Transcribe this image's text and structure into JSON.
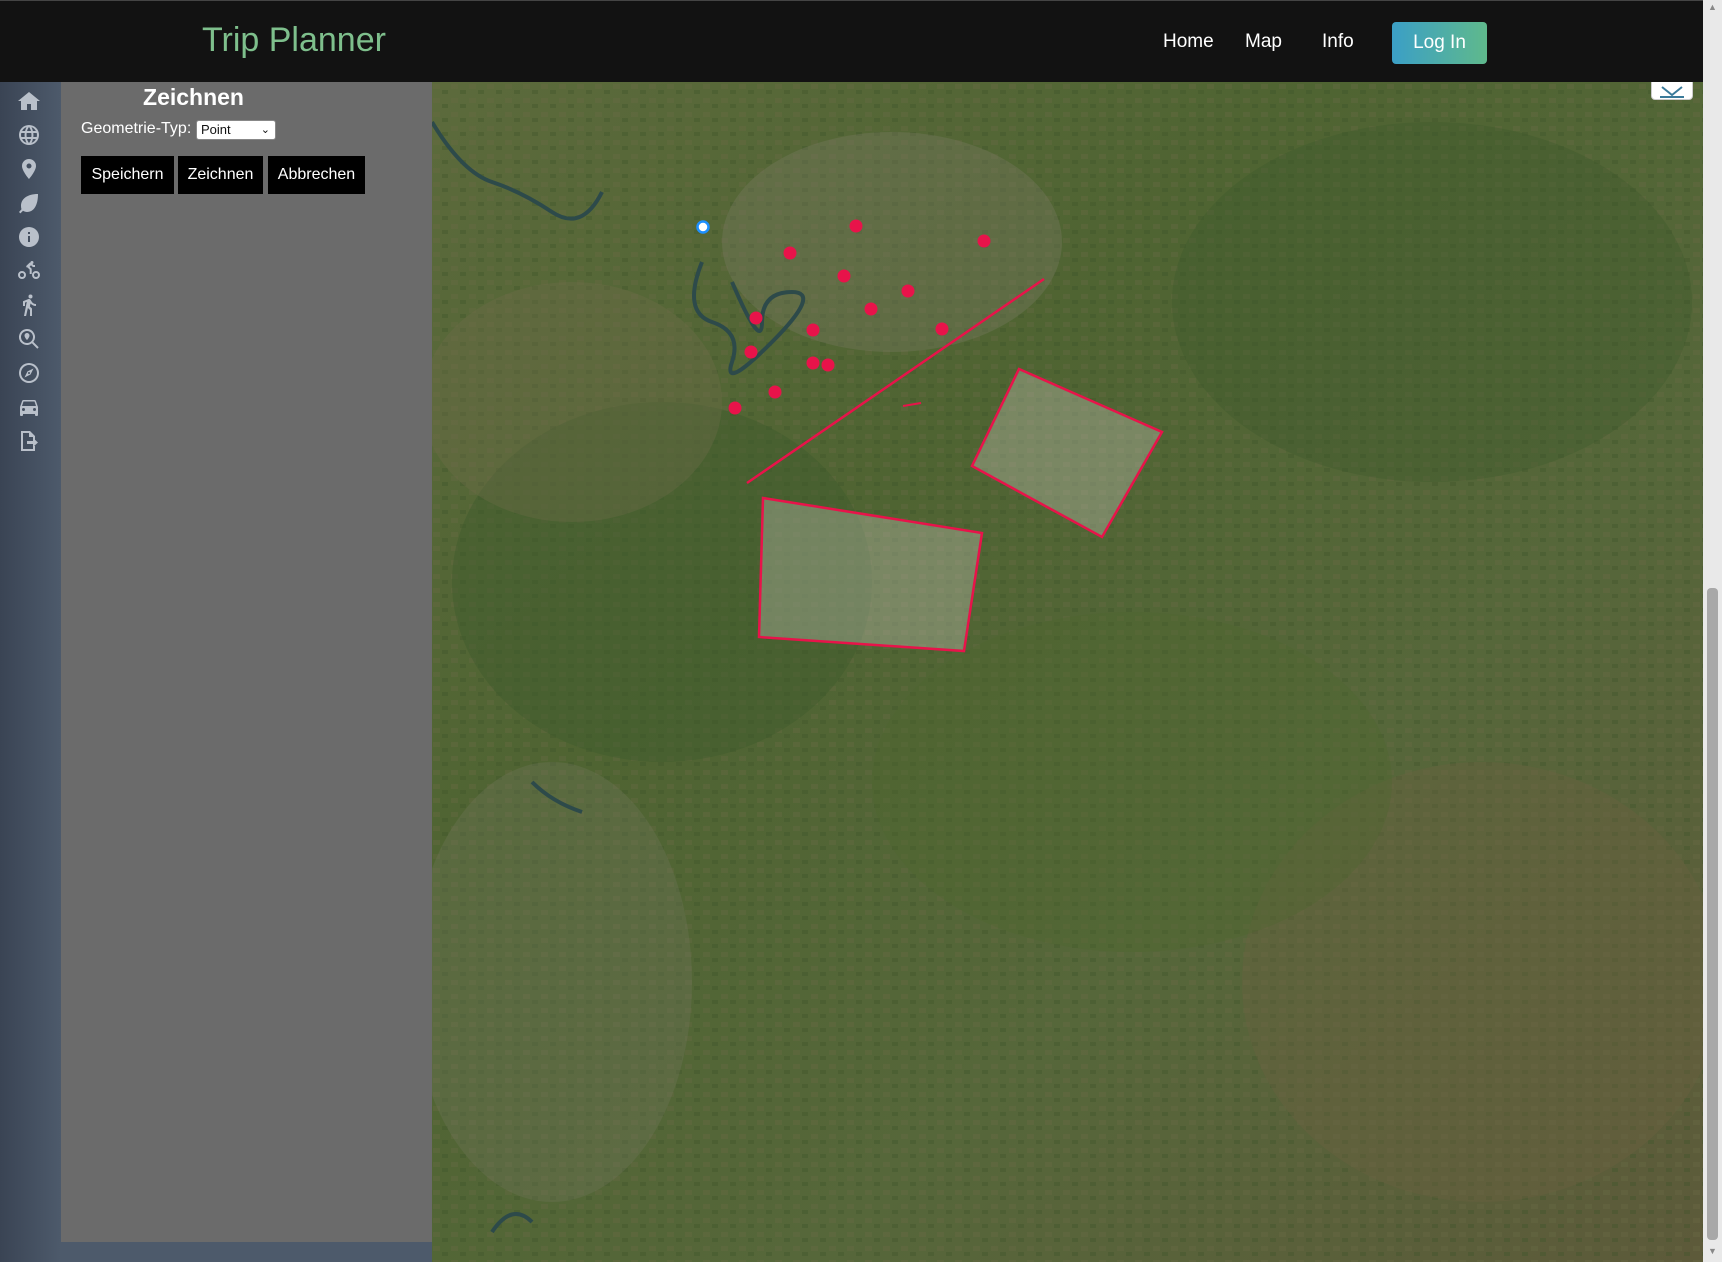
{
  "header": {
    "brand": "Trip Planner",
    "nav": [
      {
        "label": "Home"
      },
      {
        "label": "Map"
      },
      {
        "label": "Info"
      }
    ],
    "login_label": "Log In"
  },
  "sidebar_icons": [
    "home-icon",
    "globe-icon",
    "map-marker-icon",
    "leaf-icon",
    "info-icon",
    "bicycle-icon",
    "hiking-icon",
    "search-location-icon",
    "compass-icon",
    "car-icon",
    "logout-icon"
  ],
  "panel": {
    "title": "Zeichnen",
    "geometry_label": "Geometrie-Typ:",
    "geometry_value": "Point",
    "buttons": {
      "save": "Speichern",
      "draw": "Zeichnen",
      "cancel": "Abbrechen"
    }
  },
  "map": {
    "feature_color": "#e8134a",
    "selected_point_color": "#1e90ff",
    "point_count": 16,
    "line_count": 1,
    "polygon_count": 2
  }
}
